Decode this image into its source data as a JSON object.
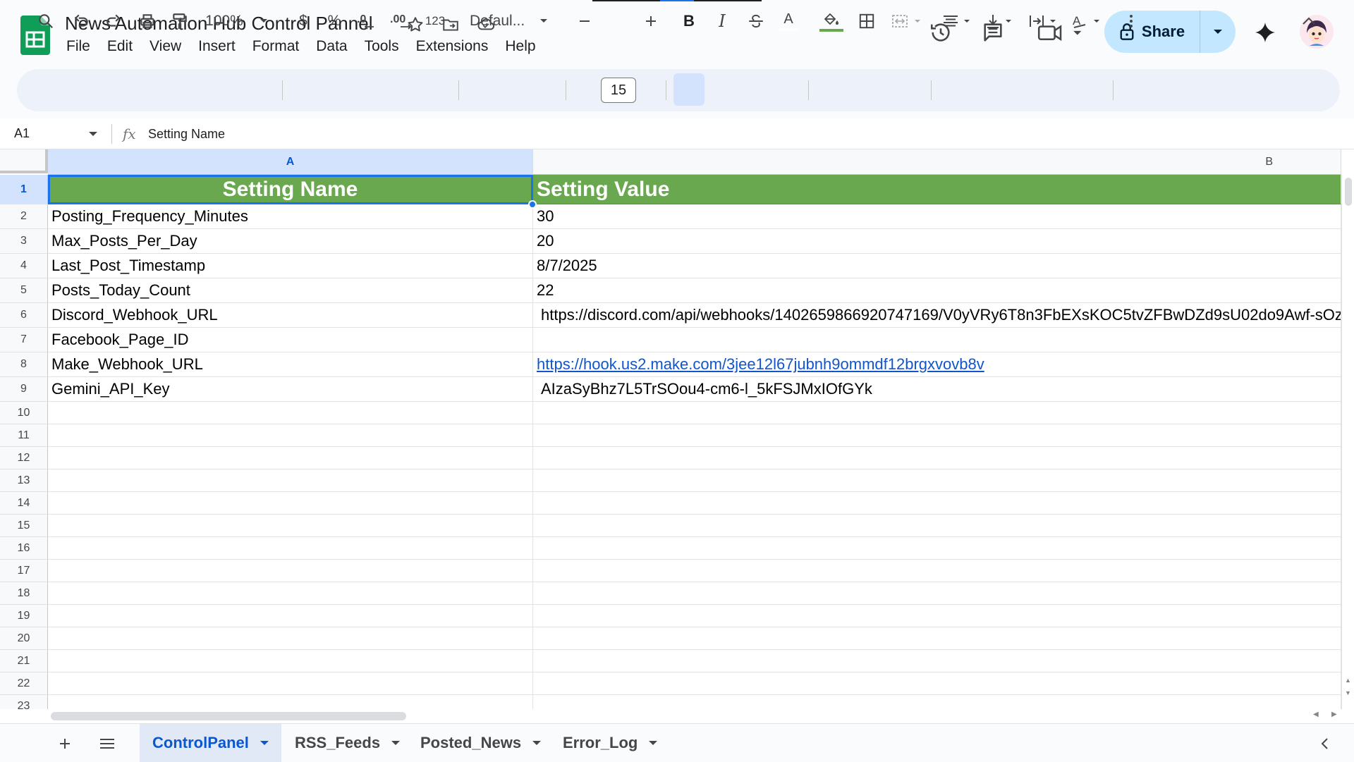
{
  "app": {
    "title": "News Automation Hub Control Pannel",
    "logo_icon": "google-sheets-logo",
    "brand_color": "#0f9d58"
  },
  "menu": [
    "File",
    "Edit",
    "View",
    "Insert",
    "Format",
    "Data",
    "Tools",
    "Extensions",
    "Help"
  ],
  "share": {
    "label": "Share",
    "bg_color": "#c2e7ff"
  },
  "toolbar": {
    "zoom": "100%",
    "currency": "$",
    "percent": "%",
    "decrease_decimal": ".0",
    "increase_decimal": ".00",
    "number_format": "123",
    "font": "Defaul...",
    "font_size": "15",
    "bold": "B",
    "italic": "I",
    "text_color": "A"
  },
  "formula_bar": {
    "namebox": "A1",
    "fx": "fx",
    "content": "Setting Name"
  },
  "columns": [
    "A",
    "B"
  ],
  "rows": [
    "1",
    "2",
    "3",
    "4",
    "5",
    "6",
    "7",
    "8",
    "9",
    "10",
    "11",
    "12",
    "13",
    "14",
    "15",
    "16",
    "17",
    "18",
    "19",
    "20",
    "21",
    "22",
    "23"
  ],
  "cells": {
    "header": [
      "Setting Name",
      "Setting Value"
    ],
    "data": [
      {
        "name": "Posting_Frequency_Minutes",
        "value": "30"
      },
      {
        "name": "Max_Posts_Per_Day",
        "value": "20"
      },
      {
        "name": "Last_Post_Timestamp",
        "value": "8/7/2025"
      },
      {
        "name": "Posts_Today_Count",
        "value": "22"
      },
      {
        "name": "Discord_Webhook_URL",
        "value": "https://discord.com/api/webhooks/1402659866920747169/V0yVRy6T8n3FbEXsKOC5tvZFBwDZd9sU02do9Awf-sOz"
      },
      {
        "name": "Facebook_Page_ID",
        "value": ""
      },
      {
        "name": "Make_Webhook_URL",
        "value": "https://hook.us2.make.com/3jee12l67jubnh9ommdf12brgxvovb8v"
      },
      {
        "name": "Gemini_API_Key",
        "value": "AIzaSyBhz7L5TrSOou4-cm6-l_5kFSJMxIOfGYk"
      }
    ],
    "header_bg": "#6aa84f",
    "link_color": "#1155cc"
  },
  "sheet_tabs": [
    {
      "label": "ControlPanel",
      "active": true
    },
    {
      "label": "RSS_Feeds",
      "active": false
    },
    {
      "label": "Posted_News",
      "active": false
    },
    {
      "label": "Error_Log",
      "active": false
    }
  ],
  "selection_color": "#1a73e8"
}
